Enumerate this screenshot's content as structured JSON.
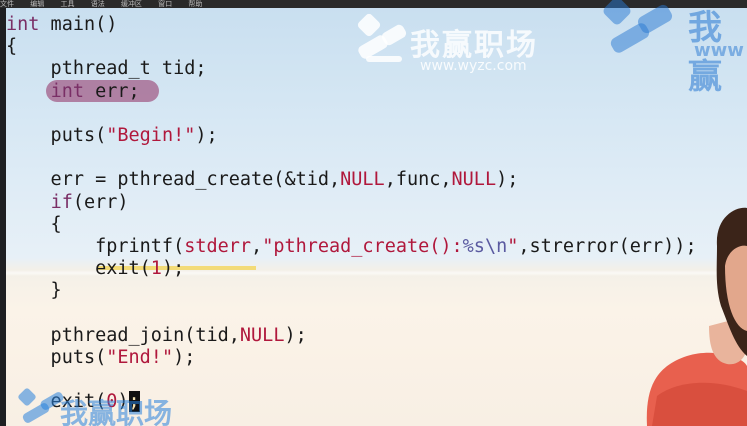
{
  "menubar": {
    "items": [
      "文件",
      "编辑",
      "工具",
      "语法",
      "缓冲区",
      "窗口",
      "帮助"
    ]
  },
  "code": {
    "lines": [
      {
        "tokens": [
          {
            "t": "int",
            "c": "kw"
          },
          {
            "t": " main()"
          }
        ]
      },
      {
        "tokens": [
          {
            "t": "{"
          }
        ]
      },
      {
        "tokens": [
          {
            "t": "    pthread_t tid;"
          }
        ]
      },
      {
        "tokens": [
          {
            "t": "    "
          },
          {
            "t": "int",
            "c": "kw"
          },
          {
            "t": " err;"
          }
        ]
      },
      {
        "tokens": [
          {
            "t": ""
          }
        ]
      },
      {
        "tokens": [
          {
            "t": "    puts("
          },
          {
            "t": "\"Begin!\"",
            "c": "str"
          },
          {
            "t": ");"
          }
        ]
      },
      {
        "tokens": [
          {
            "t": ""
          }
        ]
      },
      {
        "tokens": [
          {
            "t": "    err = pthread_create(&tid,"
          },
          {
            "t": "NULL",
            "c": "const"
          },
          {
            "t": ",func,"
          },
          {
            "t": "NULL",
            "c": "const"
          },
          {
            "t": ");"
          }
        ]
      },
      {
        "tokens": [
          {
            "t": "    "
          },
          {
            "t": "if",
            "c": "kw"
          },
          {
            "t": "(err)"
          }
        ]
      },
      {
        "tokens": [
          {
            "t": "    {"
          }
        ]
      },
      {
        "tokens": [
          {
            "t": "        fprintf("
          },
          {
            "t": "stderr",
            "c": "const"
          },
          {
            "t": ","
          },
          {
            "t": "\"pthread_create():",
            "c": "str"
          },
          {
            "t": "%s\\n",
            "c": "fmt"
          },
          {
            "t": "\"",
            "c": "str"
          },
          {
            "t": ",strerror(err));"
          }
        ]
      },
      {
        "tokens": [
          {
            "t": "        exit("
          },
          {
            "t": "1",
            "c": "const"
          },
          {
            "t": ");"
          }
        ]
      },
      {
        "tokens": [
          {
            "t": "    }"
          }
        ]
      },
      {
        "tokens": [
          {
            "t": ""
          }
        ]
      },
      {
        "tokens": [
          {
            "t": "    pthread_join(tid,"
          },
          {
            "t": "NULL",
            "c": "const"
          },
          {
            "t": ");"
          }
        ]
      },
      {
        "tokens": [
          {
            "t": "    puts("
          },
          {
            "t": "\"End!\"",
            "c": "str"
          },
          {
            "t": ");"
          }
        ]
      },
      {
        "tokens": [
          {
            "t": ""
          }
        ]
      },
      {
        "tokens": [
          {
            "t": "    exit("
          },
          {
            "t": "0",
            "c": "const"
          },
          {
            "t": ")"
          },
          {
            "t": ";",
            "c": "cursor"
          }
        ]
      }
    ]
  },
  "watermark": {
    "brand": "我赢职场",
    "url": "www.wyzc.com",
    "brand_partial": "我赢",
    "url_partial": "www"
  },
  "colors": {
    "keyword": "#7a2f66",
    "string": "#b0183c",
    "highlight_mark": "#963c6e",
    "underline": "#f3d86a"
  }
}
